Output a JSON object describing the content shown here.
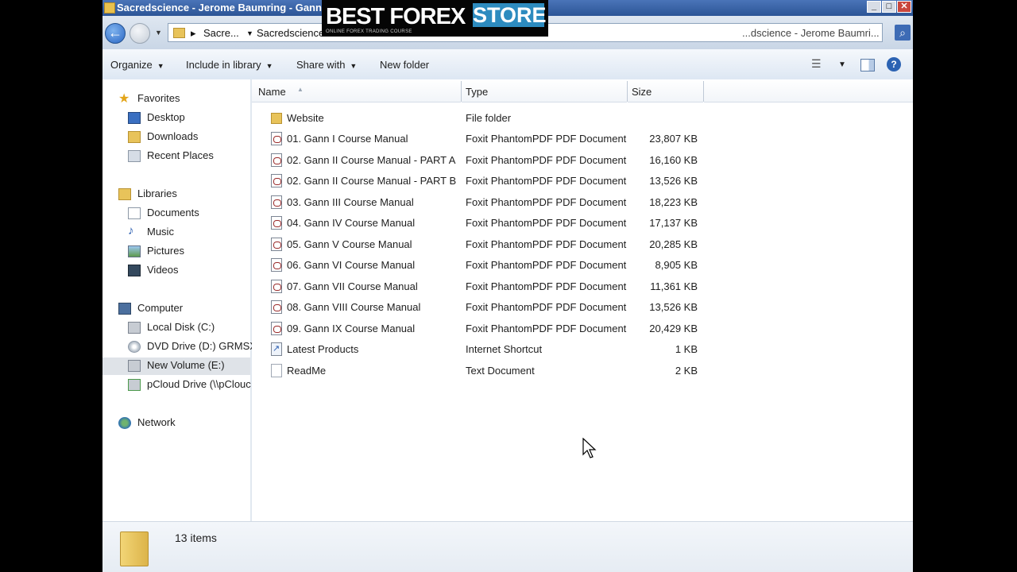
{
  "window": {
    "title": "Sacredscience - Jerome Baumring - Gann"
  },
  "watermark": {
    "brand": "BEST FOREX",
    "store": "STORE",
    "tagline": "ONLINE FOREX TRADING COURSE"
  },
  "address": {
    "crumbs": [
      "Sacre...",
      "Sacredscience - Je"
    ],
    "search_placeholder": "...dscience - Jerome Baumri..."
  },
  "toolbar": {
    "organize": "Organize",
    "include_in_library": "Include in library",
    "share_with": "Share with",
    "new_folder": "New folder"
  },
  "nav": {
    "favorites": "Favorites",
    "desktop": "Desktop",
    "downloads": "Downloads",
    "recent_places": "Recent Places",
    "libraries": "Libraries",
    "documents": "Documents",
    "music": "Music",
    "pictures": "Pictures",
    "videos": "Videos",
    "computer": "Computer",
    "local_disk": "Local Disk (C:)",
    "dvd_drive": "DVD Drive (D:) GRMSX",
    "new_volume": "New Volume (E:)",
    "pcloud": "pCloud Drive (\\\\pClouc",
    "network": "Network"
  },
  "columns": {
    "name": "Name",
    "type": "Type",
    "size": "Size"
  },
  "files": [
    {
      "name": "Website",
      "type": "File folder",
      "size": "",
      "icon": "folder-icon"
    },
    {
      "name": "01. Gann I Course Manual",
      "type": "Foxit PhantomPDF PDF Document",
      "size": "23,807 KB",
      "icon": "pdf-file-icon"
    },
    {
      "name": "02. Gann II Course Manual - PART A",
      "type": "Foxit PhantomPDF PDF Document",
      "size": "16,160 KB",
      "icon": "pdf-file-icon"
    },
    {
      "name": "02. Gann II Course Manual - PART B",
      "type": "Foxit PhantomPDF PDF Document",
      "size": "13,526 KB",
      "icon": "pdf-file-icon"
    },
    {
      "name": "03. Gann III Course Manual",
      "type": "Foxit PhantomPDF PDF Document",
      "size": "18,223 KB",
      "icon": "pdf-file-icon"
    },
    {
      "name": "04. Gann IV Course Manual",
      "type": "Foxit PhantomPDF PDF Document",
      "size": "17,137 KB",
      "icon": "pdf-file-icon"
    },
    {
      "name": "05. Gann V Course Manual",
      "type": "Foxit PhantomPDF PDF Document",
      "size": "20,285 KB",
      "icon": "pdf-file-icon"
    },
    {
      "name": "06. Gann VI Course Manual",
      "type": "Foxit PhantomPDF PDF Document",
      "size": "8,905 KB",
      "icon": "pdf-file-icon"
    },
    {
      "name": "07. Gann VII Course Manual",
      "type": "Foxit PhantomPDF PDF Document",
      "size": "11,361 KB",
      "icon": "pdf-file-icon"
    },
    {
      "name": "08. Gann VIII Course Manual",
      "type": "Foxit PhantomPDF PDF Document",
      "size": "13,526 KB",
      "icon": "pdf-file-icon"
    },
    {
      "name": "09. Gann IX Course Manual",
      "type": "Foxit PhantomPDF PDF Document",
      "size": "20,429 KB",
      "icon": "pdf-file-icon"
    },
    {
      "name": "Latest Products",
      "type": "Internet Shortcut",
      "size": "1 KB",
      "icon": "internet-shortcut-icon"
    },
    {
      "name": "ReadMe",
      "type": "Text Document",
      "size": "2 KB",
      "icon": "text-file-icon"
    }
  ],
  "status": {
    "item_count": "13 items"
  },
  "colors": {
    "titlebar": "#2c5596",
    "selection": "#dfe3e8",
    "watermark_accent": "#2d8bbf"
  }
}
